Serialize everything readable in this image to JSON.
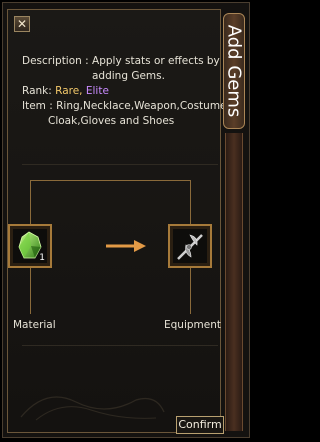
{
  "side_tab": {
    "title": "Add Gems"
  },
  "description": {
    "label": "Description :",
    "text_line1": "Apply stats or effects by",
    "text_line2": "adding Gems."
  },
  "rank": {
    "label": "Rank:",
    "rare": "Rare,",
    "elite": "Elite"
  },
  "item": {
    "label": "Item :",
    "line1": "Ring,Necklace,Weapon,Costume",
    "line2": "Cloak,Gloves and Shoes"
  },
  "slots": {
    "material": {
      "caption": "Material",
      "count": "1"
    },
    "equipment": {
      "caption": "Equipment"
    }
  },
  "buttons": {
    "confirm": "Confirm"
  },
  "colors": {
    "rare": "#f2c86a",
    "elite": "#c98bff",
    "frame": "#a67a3a"
  },
  "icons": {
    "close": "close-icon",
    "material": "green-gem-icon",
    "equipment": "weapon-axe-icon",
    "arrow": "right-arrow-icon"
  }
}
